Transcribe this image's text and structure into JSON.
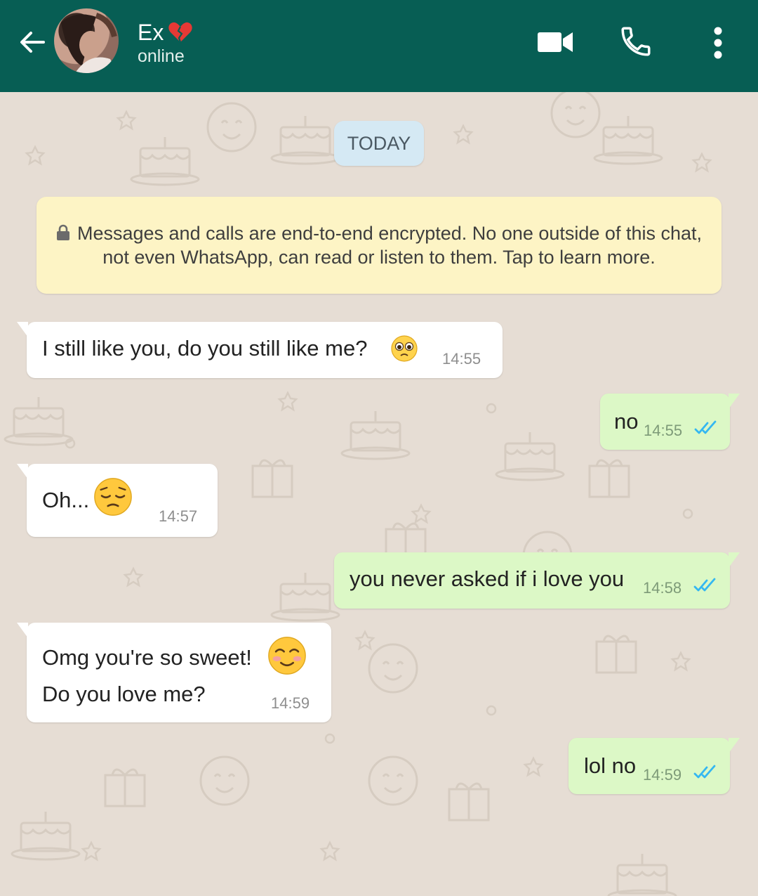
{
  "header": {
    "contact_name": "Ex",
    "status": "online",
    "colors": {
      "bar": "#075e54",
      "heart": "#e53935"
    }
  },
  "chat": {
    "date_label": "TODAY",
    "encryption_notice": "Messages and calls are end-to-end encrypted. No one outside of this chat, not even WhatsApp, can read or listen to them. Tap to learn more.",
    "messages": [
      {
        "direction": "incoming",
        "text": "I still like you, do you still like me?",
        "emoji": "pleading-face",
        "time": "14:55"
      },
      {
        "direction": "outgoing",
        "text": "no",
        "time": "14:55",
        "status": "read"
      },
      {
        "direction": "incoming",
        "text": "Oh...",
        "emoji": "pensive-face",
        "time": "14:57"
      },
      {
        "direction": "outgoing",
        "text": "you never asked if i love you",
        "time": "14:58",
        "status": "read"
      },
      {
        "direction": "incoming",
        "text": "Omg you're so sweet!",
        "emoji": "smiling-face",
        "text2": "Do you love me?",
        "time": "14:59"
      },
      {
        "direction": "outgoing",
        "text": "lol no",
        "time": "14:59",
        "status": "read"
      }
    ],
    "colors": {
      "incoming": "#ffffff",
      "outgoing": "#dcf8c6",
      "read_ticks": "#34b7f1",
      "notice": "#fdf4c5",
      "date_chip": "#d5e9f4",
      "wallpaper": "#e6ddd4"
    }
  }
}
